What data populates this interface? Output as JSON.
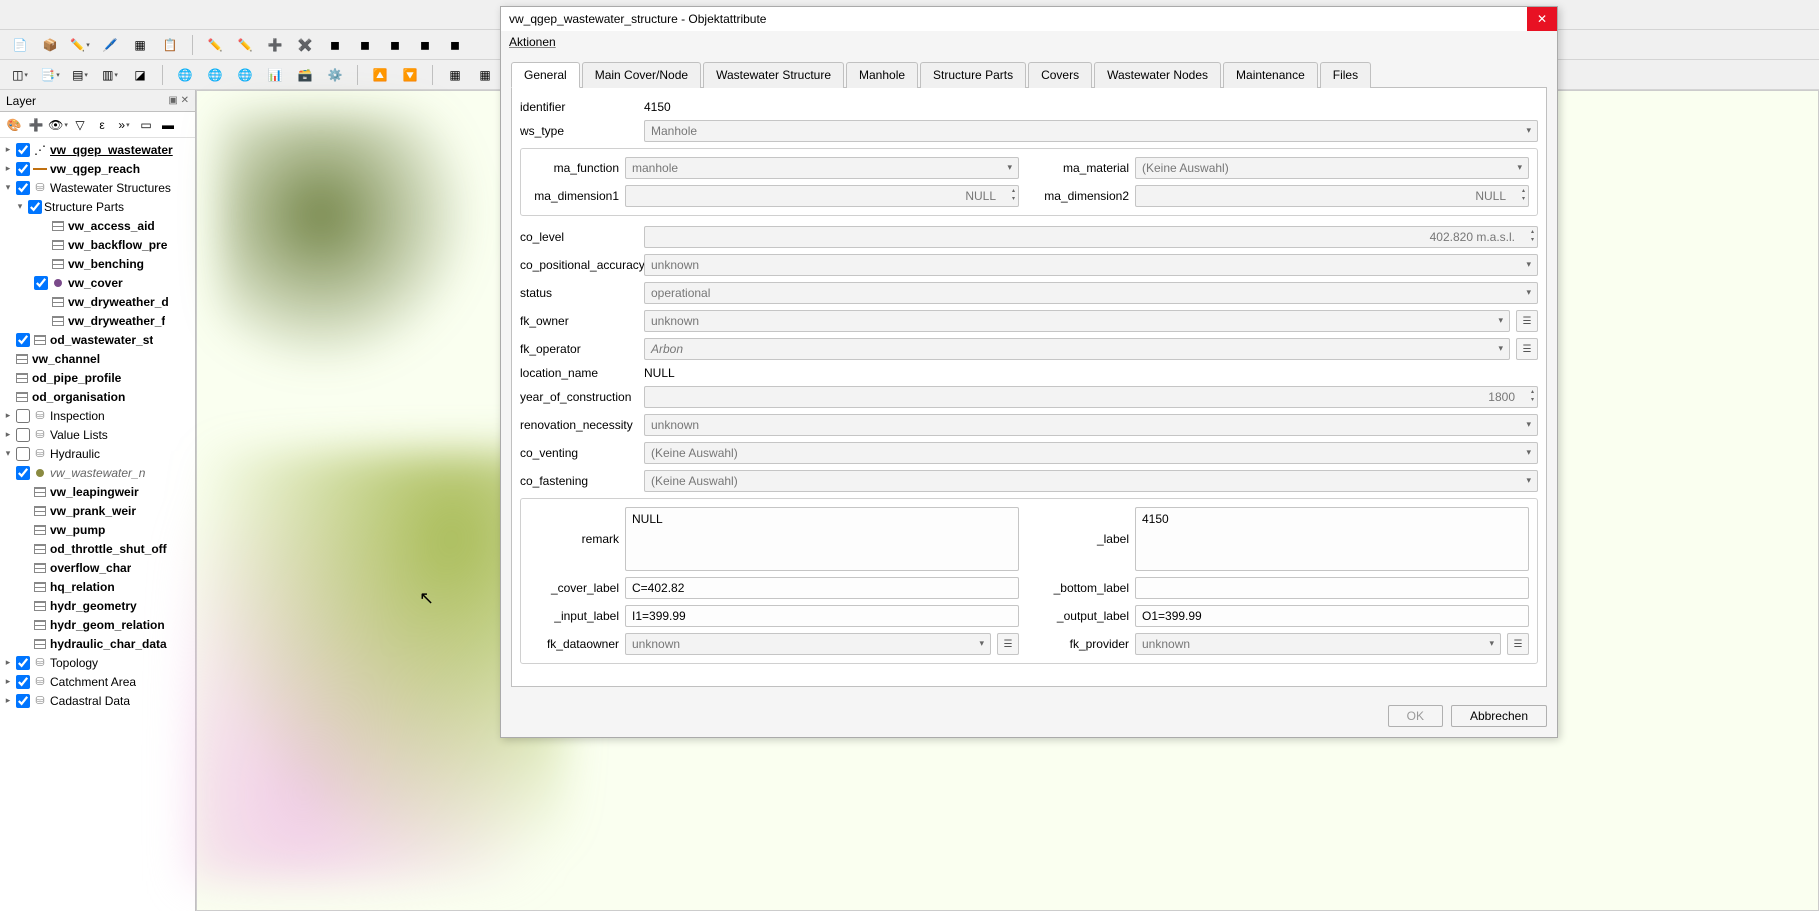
{
  "panel": {
    "title": "Layer"
  },
  "tree": {
    "vw_qgep_wastewater": "vw_qgep_wastewater",
    "vw_qgep_reach": "vw_qgep_reach",
    "wastewater_structures": "Wastewater Structures",
    "structure_parts": "Structure Parts",
    "vw_access_aid": "vw_access_aid",
    "vw_backflow_pre": "vw_backflow_pre",
    "vw_benching": "vw_benching",
    "vw_cover": "vw_cover",
    "vw_dryweather_d": "vw_dryweather_d",
    "vw_dryweather_f": "vw_dryweather_f",
    "od_wastewater_st": "od_wastewater_st",
    "vw_channel": "vw_channel",
    "od_pipe_profile": "od_pipe_profile",
    "od_organisation": "od_organisation",
    "inspection": "Inspection",
    "value_lists": "Value Lists",
    "hydraulic": "Hydraulic",
    "vw_wastewater_n": "vw_wastewater_n",
    "vw_leapingweir": "vw_leapingweir",
    "vw_prank_weir": "vw_prank_weir",
    "vw_pump": "vw_pump",
    "od_throttle_shut_off": "od_throttle_shut_off",
    "overflow_char": "overflow_char",
    "hq_relation": "hq_relation",
    "hydr_geometry": "hydr_geometry",
    "hydr_geom_relation": "hydr_geom_relation",
    "hydraulic_char_data": "hydraulic_char_data",
    "topology": "Topology",
    "catchment_area": "Catchment Area",
    "cadastral_data": "Cadastral Data"
  },
  "dialog": {
    "title": "vw_qgep_wastewater_structure - Objektattribute",
    "menu": "Aktionen",
    "tabs": [
      "General",
      "Main Cover/Node",
      "Wastewater Structure",
      "Manhole",
      "Structure Parts",
      "Covers",
      "Wastewater Nodes",
      "Maintenance",
      "Files"
    ],
    "ok": "OK",
    "cancel": "Abbrechen"
  },
  "labels": {
    "identifier": "identifier",
    "ws_type": "ws_type",
    "ma_function": "ma_function",
    "ma_material": "ma_material",
    "ma_dimension1": "ma_dimension1",
    "ma_dimension2": "ma_dimension2",
    "co_level": "co_level",
    "co_positional_accuracy": "co_positional_accuracy",
    "status": "status",
    "fk_owner": "fk_owner",
    "fk_operator": "fk_operator",
    "location_name": "location_name",
    "year_of_construction": "year_of_construction",
    "renovation_necessity": "renovation_necessity",
    "co_venting": "co_venting",
    "co_fastening": "co_fastening",
    "remark": "remark",
    "label": "_label",
    "cover_label": "_cover_label",
    "bottom_label": "_bottom_label",
    "input_label": "_input_label",
    "output_label": "_output_label",
    "fk_dataowner": "fk_dataowner",
    "fk_provider": "fk_provider"
  },
  "values": {
    "identifier": "4150",
    "ws_type": "Manhole",
    "ma_function": "manhole",
    "ma_material": "(Keine Auswahl)",
    "ma_dimension1": "NULL",
    "ma_dimension2": "NULL",
    "co_level": "402.820 m.a.s.l.",
    "co_positional_accuracy": "unknown",
    "status": "operational",
    "fk_owner": "unknown",
    "fk_operator": "Arbon",
    "location_name": "NULL",
    "year_of_construction": "1800",
    "renovation_necessity": "unknown",
    "co_venting": "(Keine Auswahl)",
    "co_fastening": "(Keine Auswahl)",
    "remark": "NULL",
    "label_val": "4150",
    "cover_label": "C=402.82",
    "bottom_label": "",
    "input_label": "I1=399.99",
    "output_label": "O1=399.99",
    "fk_dataowner": "unknown",
    "fk_provider": "unknown"
  }
}
